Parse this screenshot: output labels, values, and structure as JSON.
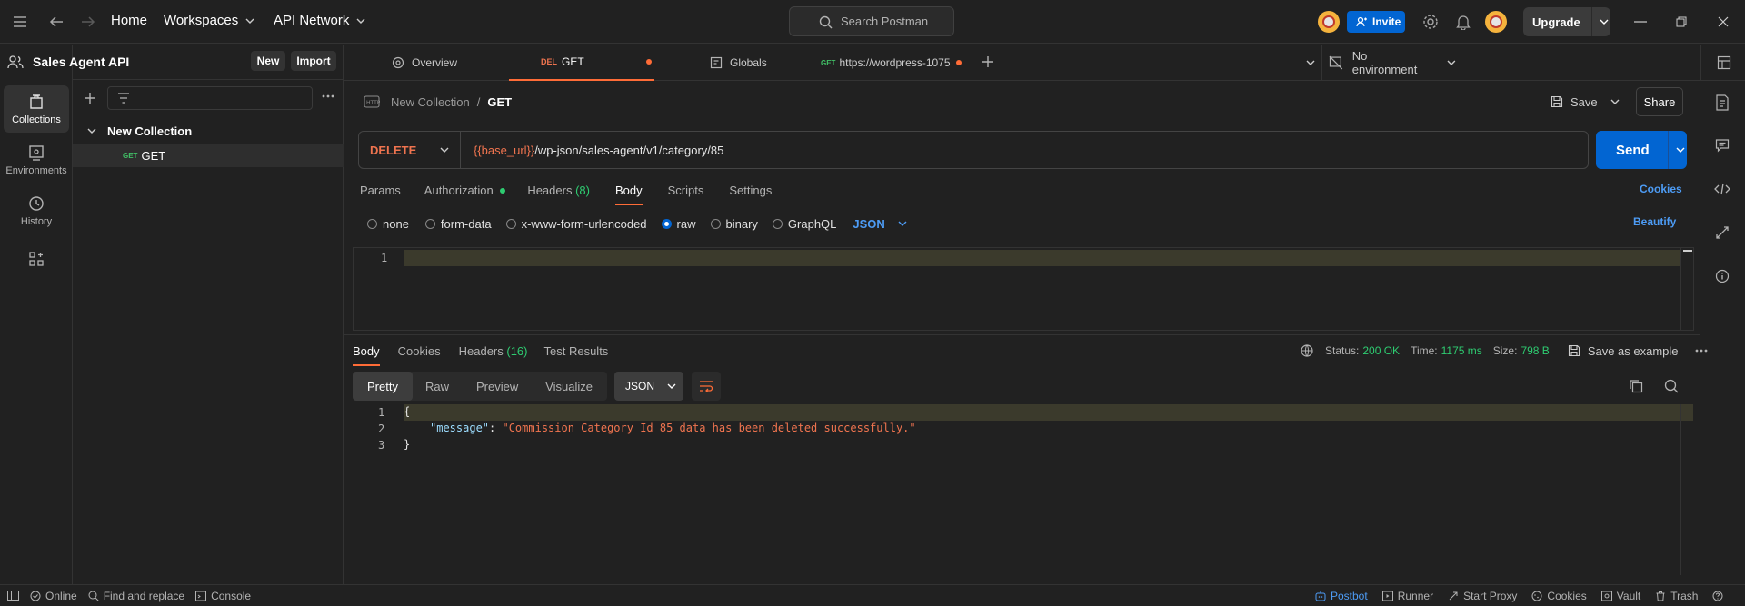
{
  "topbar": {
    "home": "Home",
    "workspaces": "Workspaces",
    "api_network": "API Network",
    "search_placeholder": "Search Postman",
    "invite": "Invite",
    "upgrade": "Upgrade"
  },
  "rail": {
    "collections": "Collections",
    "environments": "Environments",
    "history": "History"
  },
  "workspace": {
    "name": "Sales Agent API",
    "new_button": "New",
    "import_button": "Import"
  },
  "tree": {
    "collection": "New Collection",
    "request_method": "GET",
    "request_name": "GET"
  },
  "tabs": [
    {
      "label": "Overview"
    },
    {
      "method": "DEL",
      "label": "GET"
    },
    {
      "label": "Globals"
    },
    {
      "method": "GET",
      "label": "https://wordpress-1075"
    }
  ],
  "environment": {
    "label": "No environment"
  },
  "request": {
    "breadcrumb_collection": "New Collection",
    "breadcrumb_sep": "/",
    "breadcrumb_request": "GET",
    "save": "Save",
    "share": "Share",
    "method": "DELETE",
    "url_var": "{{base_url}}",
    "url_path": "/wp-json/sales-agent/v1/category/85",
    "send": "Send"
  },
  "request_tabs": {
    "params": "Params",
    "authorization": "Authorization",
    "headers": "Headers",
    "headers_count": "(8)",
    "body": "Body",
    "scripts": "Scripts",
    "settings": "Settings",
    "cookies": "Cookies"
  },
  "body_types": {
    "none": "none",
    "form_data": "form-data",
    "urlencoded": "x-www-form-urlencoded",
    "raw": "raw",
    "binary": "binary",
    "graphql": "GraphQL",
    "format": "JSON",
    "beautify": "Beautify"
  },
  "request_editor": {
    "line1": "1"
  },
  "response_tabs": {
    "body": "Body",
    "cookies": "Cookies",
    "headers": "Headers",
    "headers_count": "(16)",
    "test_results": "Test Results"
  },
  "response_meta": {
    "status_label": "Status:",
    "status_value": "200 OK",
    "time_label": "Time:",
    "time_value": "1175 ms",
    "size_label": "Size:",
    "size_value": "798 B",
    "save_example": "Save as example"
  },
  "response_view": {
    "pretty": "Pretty",
    "raw": "Raw",
    "preview": "Preview",
    "visualize": "Visualize",
    "format": "JSON"
  },
  "response_code": {
    "lines": [
      "1",
      "2",
      "3"
    ],
    "open_brace": "{",
    "key": "\"message\"",
    "colon": ": ",
    "value": "\"Commission Category Id 85 data has been deleted successfully.\"",
    "close_brace": "}"
  },
  "statusbar": {
    "online": "Online",
    "find_replace": "Find and replace",
    "console": "Console",
    "postbot": "Postbot",
    "runner": "Runner",
    "start_proxy": "Start Proxy",
    "cookies": "Cookies",
    "vault": "Vault",
    "trash": "Trash"
  },
  "colors": {
    "accent_orange": "#ff6c37",
    "blue": "#0265d2",
    "link_blue": "#4d9cf5",
    "green": "#2ecc71",
    "method_delete": "#f0744f",
    "method_get": "#41c066"
  }
}
